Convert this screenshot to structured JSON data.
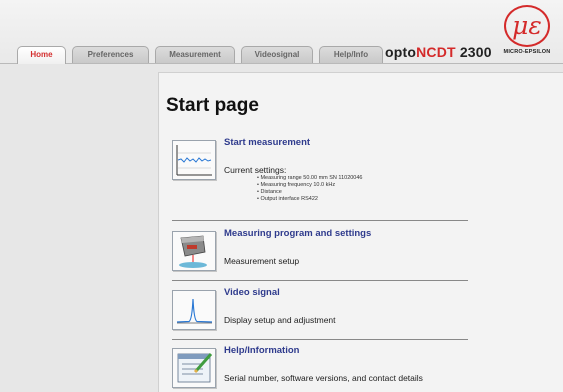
{
  "tabs": [
    {
      "label": "Home"
    },
    {
      "label": "Preferences"
    },
    {
      "label": "Measurement"
    },
    {
      "label": "Videosignal"
    },
    {
      "label": "Help/Info"
    }
  ],
  "brand": {
    "prefix": "opto",
    "highlight": "NCDT",
    "model": "2300"
  },
  "logo": {
    "mark": "με",
    "text": "MICRO-EPSILON"
  },
  "page_title": "Start page",
  "items": [
    {
      "heading": "Start measurement",
      "description": "Current settings:",
      "details": [
        "Measuring range 50.00 mm SN 11020046",
        "Measuring frequency 10.0 kHz",
        "Distance",
        "Output interface RS422"
      ],
      "icon": "signal-chart-icon"
    },
    {
      "heading": "Measuring program and settings",
      "description": "Measurement setup",
      "icon": "sensor-device-icon"
    },
    {
      "heading": "Video signal",
      "description": "Display setup and adjustment",
      "icon": "peak-signal-icon"
    },
    {
      "heading": "Help/Information",
      "description": "Serial number, software versions, and contact details",
      "icon": "document-pencil-icon"
    }
  ],
  "colors": {
    "accent": "#d42a2a",
    "link": "#2f3b8d"
  }
}
